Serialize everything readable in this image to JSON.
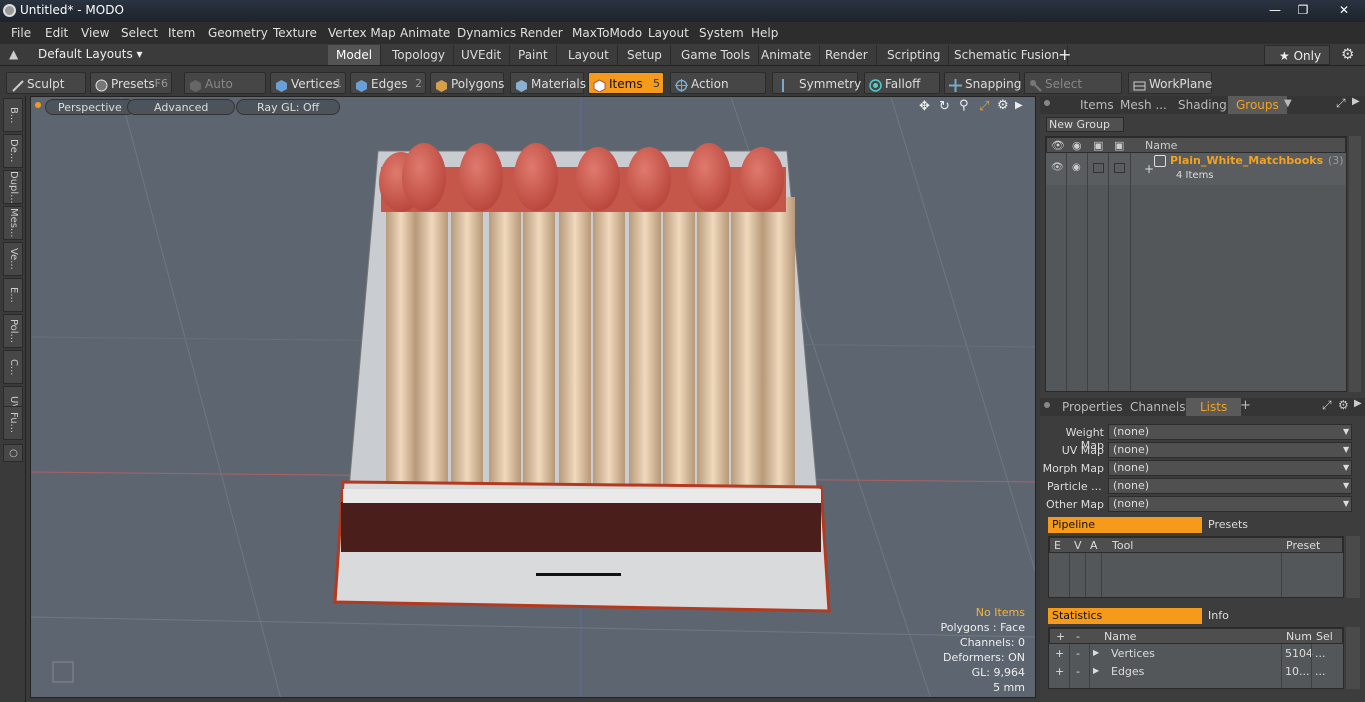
{
  "window": {
    "title": "Untitled* - MODO"
  },
  "menu": [
    "File",
    "Edit",
    "View",
    "Select",
    "Item",
    "Geometry",
    "Texture",
    "Vertex Map",
    "Animate",
    "Dynamics",
    "Render",
    "MaxToModo",
    "Layout",
    "System",
    "Help"
  ],
  "layout": {
    "preset": "Default Layouts ▾",
    "tabs": [
      "Model",
      "Topology",
      "UVEdit",
      "Paint",
      "Layout",
      "Setup",
      "Game Tools",
      "Animate",
      "Render",
      "Scripting",
      "Schematic Fusion"
    ],
    "active": "Model",
    "only_label": "★  Only"
  },
  "toolbar": {
    "sculpt": "Sculpt",
    "presets": "Presets",
    "presets_key": "F6",
    "auto_select": "Auto Select",
    "vertices": "Vertices",
    "vertices_key": "1",
    "edges": "Edges",
    "edges_key": "2",
    "polygons": "Polygons",
    "materials": "Materials",
    "items": "Items",
    "items_key": "5",
    "action_center": "Action Center",
    "symmetry": "Symmetry",
    "falloff": "Falloff",
    "snapping": "Snapping",
    "select_through": "Select Through",
    "workplane": "WorkPlane"
  },
  "leftstrip": [
    "B...",
    "De...",
    "Dupl...",
    "Mes...",
    "Ve...",
    "E...",
    "Pol...",
    "C...",
    "UV",
    "Fu..."
  ],
  "viewport": {
    "perspective": "Perspective",
    "advanced": "Advanced",
    "raygl": "Ray GL: Off",
    "stats": {
      "no_items": "No Items",
      "polygons": "Polygons : Face",
      "channels": "Channels: 0",
      "deformers": "Deformers: ON",
      "gl": "GL: 9,964",
      "units": "5 mm"
    }
  },
  "groups_panel": {
    "tabs": [
      "Items",
      "Mesh ...",
      "Shading",
      "Groups"
    ],
    "active": "Groups",
    "new_group": "New Group",
    "name_header": "Name",
    "group_name": "Plain_White_Matchbooks",
    "group_count": "(3) ...",
    "group_items": "4 Items"
  },
  "lists_panel": {
    "tabs": [
      "Properties",
      "Channels",
      "Lists"
    ],
    "active": "Lists",
    "maps": [
      {
        "label": "Weight Map",
        "value": "(none)"
      },
      {
        "label": "UV Map",
        "value": "(none)"
      },
      {
        "label": "Morph Map",
        "value": "(none)"
      },
      {
        "label": "Particle    ...",
        "value": "(none)"
      },
      {
        "label": "Other Map",
        "value": "(none)"
      }
    ],
    "pipeline": "Pipeline",
    "presets": "Presets",
    "pipe_cols": [
      "E",
      "V",
      "A",
      "Tool",
      "Preset"
    ]
  },
  "stats_panel": {
    "statistics": "Statistics",
    "info": "Info",
    "cols": [
      "+",
      "-",
      "Name",
      "Num",
      "Sel"
    ],
    "rows": [
      {
        "name": "Vertices",
        "num": "5104",
        "sel": "..."
      },
      {
        "name": "Edges",
        "num": "10...",
        "sel": "..."
      }
    ]
  },
  "colors": {
    "accent": "#f59a1b",
    "viewport": "#5d6670"
  }
}
